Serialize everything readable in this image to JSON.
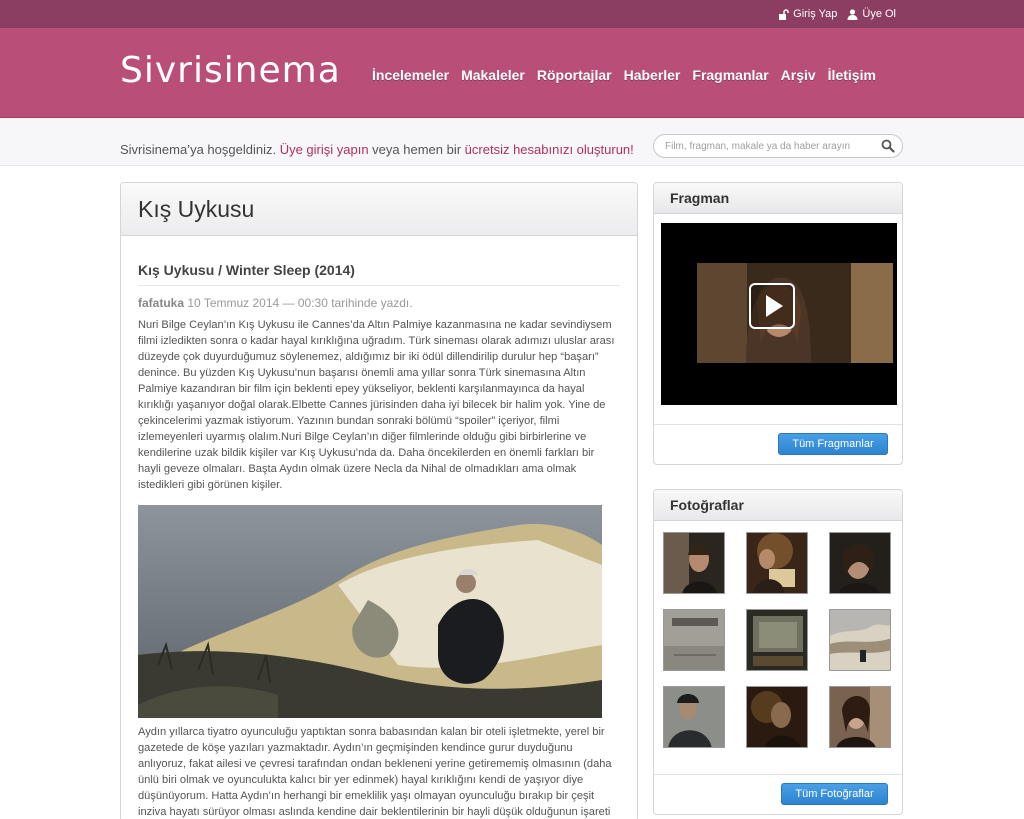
{
  "topbar": {
    "login": "Giriş Yap",
    "register": "Üye Ol"
  },
  "logo": "Sivrisinema",
  "nav": [
    "İncelemeler",
    "Makaleler",
    "Röportajlar",
    "Haberler",
    "Fragmanlar",
    "Arşiv",
    "İletişim"
  ],
  "welcome": {
    "prefix": "Sivrisinema’ya hoşgeldiniz. ",
    "login_link": "Üye girişi yapın",
    "middle": " veya hemen bir ",
    "signup_link": "ücretsiz hesabınızı oluşturun!"
  },
  "search": {
    "placeholder": "Film, fragman, makale ya da haber arayın"
  },
  "page_title": "Kış Uykusu",
  "article": {
    "title": "Kış Uykusu / Winter Sleep (2014)",
    "author": "fafatuka",
    "date_text": " 10 Temmuz 2014 — 00:30 tarihinde yazdı.",
    "p1": "Nuri Bilge Ceylan’ın Kış Uykusu ile Cannes’da Altın Palmiye kazanmasına ne kadar sevindiysem filmi izledikten sonra o kadar hayal kırıklığına uğradım. Türk sineması olarak adımızı uluslar arası düzeyde çok duyurduğumuz söylenemez, aldığımız bir iki ödül dillendirilip durulur hep “başarı” denince. Bu yüzden Kış Uykusu’nun  başarısı önemli ama yıllar sonra  Türk sinemasına Altın Palmiye kazandıran  bir film için beklenti epey yükseliyor, beklenti karşılanmayınca da hayal kırıklığı yaşanıyor doğal olarak.Elbette Cannes jürisinden daha iyi bilecek bir halim yok. Yine de çekincelerimi yazmak istiyorum. Yazının bundan sonraki bölümü “spoiler” içeriyor, filmi izlemeyenleri uyarmış olalım.Nuri Bilge Ceylan’ın diğer filmlerinde olduğu gibi birbirlerine ve kendilerine uzak bildik kişiler var Kış Uykusu’nda da. Daha öncekilerden en önemli farkları bir hayli geveze olmaları. Başta Aydın olmak üzere Necla da Nihal de olmadıkları ama olmak istedikleri gibi görünen kişiler.",
    "p2": "Aydın yıllarca tiyatro oyunculuğu yaptıktan sonra babasından kalan bir oteli işletmekte, yerel bir gazetede de köşe yazıları yazmaktadır. Aydın’ın geçmişinden kendince gurur duyduğunu anlıyoruz, fakat ailesi ve çevresi tarafından ondan bekleneni yerine getirememiş olmasının (daha ünlü biri olmak ve oyunculukta kalıcı bir yer edinmek) hayal kırıklığını kendi de yaşıyor diye düşünüyorum. Hatta Aydın’ın herhangi bir emeklilik yaşı olmayan oyunculuğu bırakıp bir çeşit inziva hayatı sürüyor olması aslında kendine dair beklentilerinin bir hayli düşük olduğunun işareti"
  },
  "trailer": {
    "title": "Fragman",
    "button": "Tüm Fragmanlar"
  },
  "photos": {
    "title": "Fotoğraflar",
    "button": "Tüm Fotoğraflar"
  },
  "colors": {
    "topbar": "#8c3e62",
    "header": "#b94e79",
    "accent": "#b0305f",
    "button": "#3a90dc"
  }
}
